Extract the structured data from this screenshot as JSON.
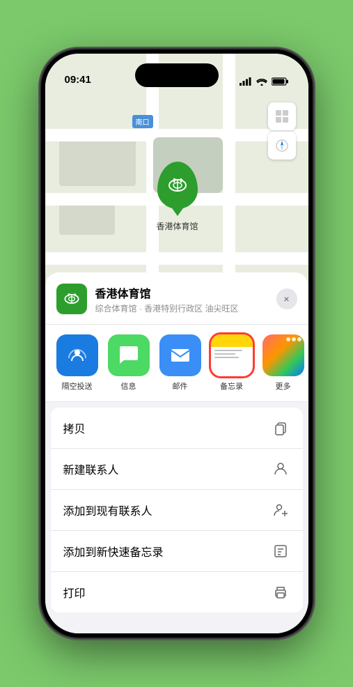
{
  "status": {
    "time": "09:41",
    "location_arrow": true
  },
  "map": {
    "south_label": "南口",
    "south_label_prefix": "南"
  },
  "location": {
    "name": "香港体育馆",
    "subtitle": "综合体育馆 · 香港特别行政区 油尖旺区"
  },
  "share_items": [
    {
      "id": "airdrop",
      "label": "隔空投送",
      "type": "airdrop"
    },
    {
      "id": "message",
      "label": "信息",
      "type": "message"
    },
    {
      "id": "mail",
      "label": "邮件",
      "type": "mail"
    },
    {
      "id": "notes",
      "label": "备忘录",
      "type": "notes",
      "selected": true
    },
    {
      "id": "more",
      "label": "更多",
      "type": "more"
    }
  ],
  "actions": [
    {
      "id": "copy",
      "label": "拷贝",
      "icon": "copy"
    },
    {
      "id": "new-contact",
      "label": "新建联系人",
      "icon": "person-plus"
    },
    {
      "id": "add-existing",
      "label": "添加到现有联系人",
      "icon": "person-add"
    },
    {
      "id": "add-notes",
      "label": "添加到新快速备忘录",
      "icon": "notes-add"
    },
    {
      "id": "print",
      "label": "打印",
      "icon": "printer"
    }
  ],
  "close_label": "×"
}
